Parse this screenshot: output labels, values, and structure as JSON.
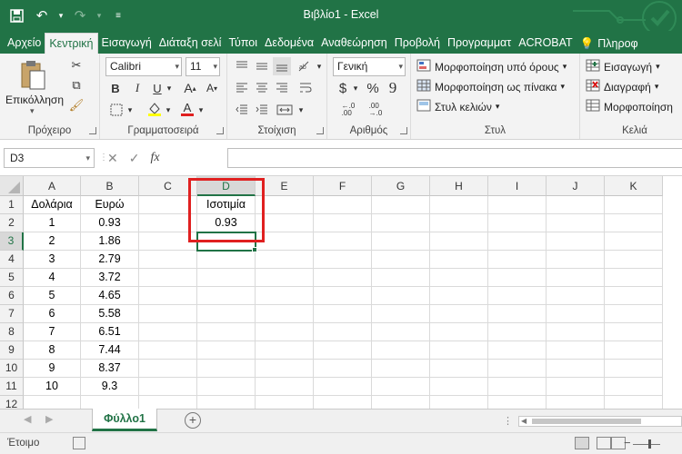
{
  "window": {
    "title": "Βιβλίο1 - Excel"
  },
  "qat": {
    "save_icon": "save-icon",
    "undo_icon": "undo-icon",
    "redo_icon": "redo-icon",
    "customize_icon": "customize-qat-icon"
  },
  "tabs": [
    {
      "label": "Αρχείο"
    },
    {
      "label": "Κεντρική"
    },
    {
      "label": "Εισαγωγή"
    },
    {
      "label": "Διάταξη σελί"
    },
    {
      "label": "Τύποι"
    },
    {
      "label": "Δεδομένα"
    },
    {
      "label": "Αναθεώρηση"
    },
    {
      "label": "Προβολή"
    },
    {
      "label": "Προγραμματ"
    },
    {
      "label": "ACROBAT"
    },
    {
      "label": "Πληροφ"
    }
  ],
  "ribbon": {
    "clipboard": {
      "paste_label": "Επικόλληση",
      "group_label": "Πρόχειρο"
    },
    "font": {
      "font_name": "Calibri",
      "font_size": "11",
      "group_label": "Γραμματοσειρά",
      "bold": "B",
      "italic": "I",
      "underline": "U"
    },
    "alignment": {
      "group_label": "Στοίχιση"
    },
    "number": {
      "format": "Γενική",
      "group_label": "Αριθμός",
      "currency": "$",
      "percent": "%",
      "comma": "9"
    },
    "styles": {
      "conditional": "Μορφοποίηση υπό όρους",
      "as_table": "Μορφοποίηση ως πίνακα",
      "cell_styles": "Στυλ κελιών",
      "group_label": "Στυλ"
    },
    "cells": {
      "insert": "Εισαγωγή",
      "delete": "Διαγραφή",
      "format": "Μορφοποίηση",
      "group_label": "Κελιά"
    }
  },
  "formula_bar": {
    "name_box": "D3",
    "fx": "fx",
    "formula": ""
  },
  "columns": [
    "A",
    "B",
    "C",
    "D",
    "E",
    "F",
    "G",
    "H",
    "I",
    "J",
    "K"
  ],
  "rows": [
    "1",
    "2",
    "3",
    "4",
    "5",
    "6",
    "7",
    "8",
    "9",
    "10",
    "11",
    "12"
  ],
  "cells": {
    "A1": "Δολάρια",
    "B1": "Ευρώ",
    "D1": "Ισοτιμία",
    "D2": "0.93",
    "A2": "1",
    "B2": "0.93",
    "A3": "2",
    "B3": "1.86",
    "A4": "3",
    "B4": "2.79",
    "A5": "4",
    "B5": "3.72",
    "A6": "5",
    "B6": "4.65",
    "A7": "6",
    "B7": "5.58",
    "A8": "7",
    "B8": "6.51",
    "A9": "8",
    "B9": "7.44",
    "A10": "9",
    "B10": "8.37",
    "A11": "10",
    "B11": "9.3"
  },
  "active_cell": "D3",
  "sheet": {
    "tab": "Φύλλο1"
  },
  "status": {
    "text": "Έτοιμο"
  },
  "colors": {
    "accent": "#217346",
    "highlight": "#e02020"
  }
}
